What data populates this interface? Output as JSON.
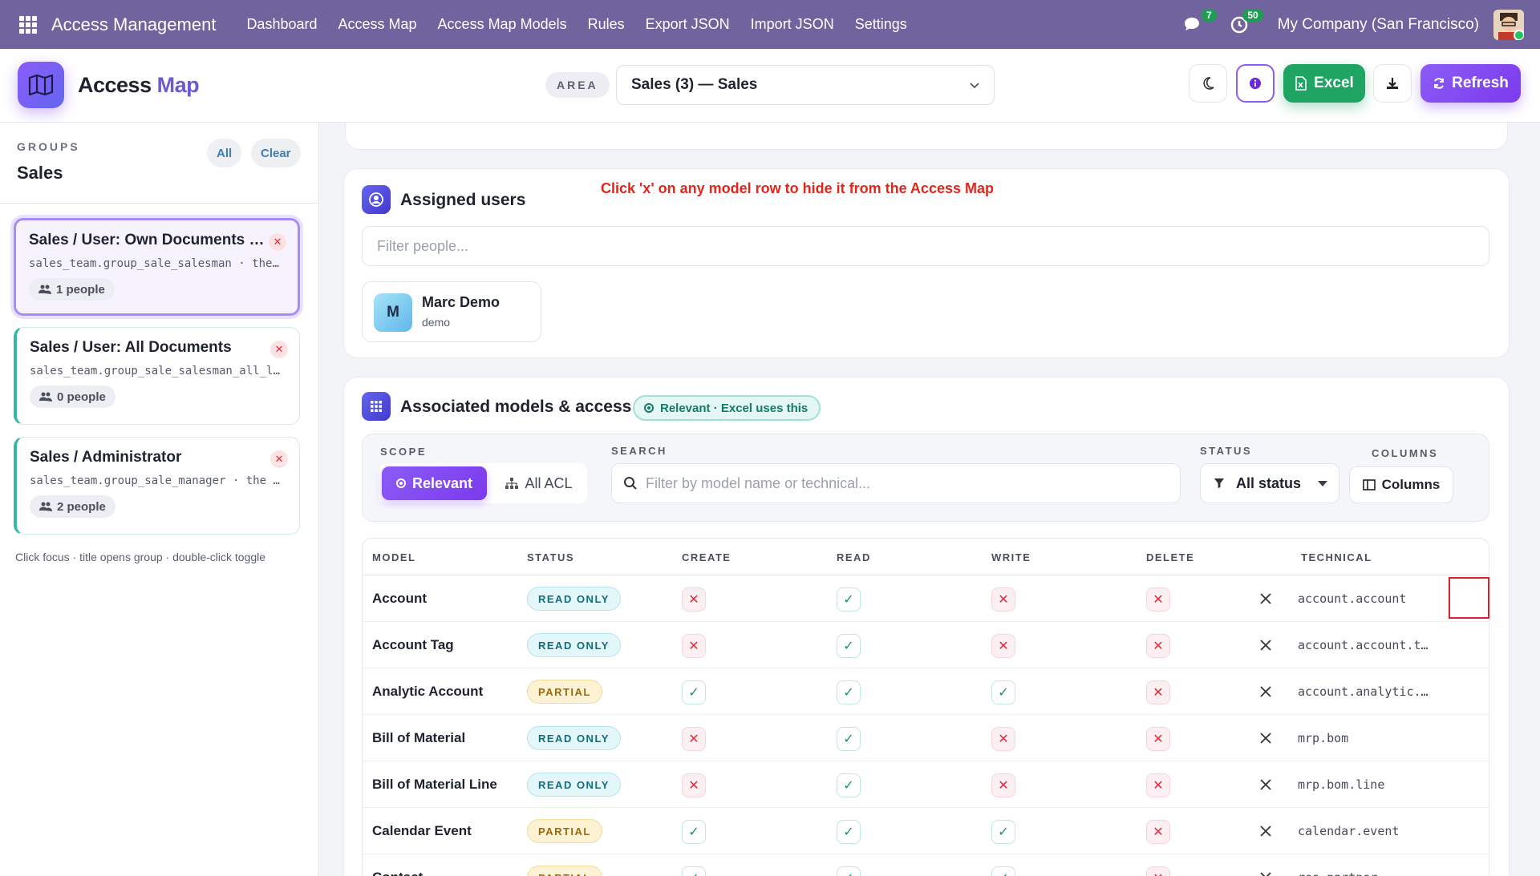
{
  "topbar": {
    "brand": "Access Management",
    "nav": [
      "Dashboard",
      "Access Map",
      "Access Map Models",
      "Rules",
      "Export JSON",
      "Import JSON",
      "Settings"
    ],
    "messages_count": "7",
    "activity_count": "50",
    "company": "My Company (San Francisco)"
  },
  "header": {
    "title_main": "Access",
    "title_accent": "Map",
    "area_label": "AREA",
    "area_value": "Sales (3) — Sales",
    "excel_label": "Excel",
    "refresh_label": "Refresh"
  },
  "sidebar": {
    "groups_label": "GROUPS",
    "groups_title": "Sales",
    "all_label": "All",
    "clear_label": "Clear",
    "groups": [
      {
        "title": "Sales / User: Own Documents Only",
        "tech": "sales_team.group_sale_salesman · the user will have access to his own data",
        "people": "1 people"
      },
      {
        "title": "Sales / User: All Documents",
        "tech": "sales_team.group_sale_salesman_all_leads",
        "people": "0 people"
      },
      {
        "title": "Sales / Administrator",
        "tech": "sales_team.group_sale_manager · the user will have access to all",
        "people": "2 people"
      }
    ],
    "hint": "Click focus · title opens group · double-click toggle"
  },
  "users": {
    "title": "Assigned users",
    "annotation": "Click 'x' on any model row to hide it from the Access Map",
    "filter_placeholder": "Filter people...",
    "list": [
      {
        "initial": "M",
        "name": "Marc Demo",
        "login": "demo"
      }
    ]
  },
  "models": {
    "title": "Associated models & access",
    "relevant_badge": "Relevant · Excel uses this",
    "scope_label": "SCOPE",
    "scope_relevant": "Relevant",
    "scope_all": "All ACL",
    "search_label": "SEARCH",
    "search_placeholder": "Filter by model name or technical...",
    "status_label": "STATUS",
    "status_value": "All status",
    "columns_label": "COLUMNS",
    "columns_button": "Columns",
    "headers": [
      "MODEL",
      "STATUS",
      "CREATE",
      "READ",
      "WRITE",
      "DELETE",
      "TECHNICAL"
    ],
    "rows": [
      {
        "model": "Account",
        "status": "READ ONLY",
        "kind": "read",
        "c": false,
        "r": true,
        "w": false,
        "d": false,
        "tech": "account.account"
      },
      {
        "model": "Account Tag",
        "status": "READ ONLY",
        "kind": "read",
        "c": false,
        "r": true,
        "w": false,
        "d": false,
        "tech": "account.account.tag"
      },
      {
        "model": "Analytic Account",
        "status": "PARTIAL",
        "kind": "part",
        "c": true,
        "r": true,
        "w": true,
        "d": false,
        "tech": "account.analytic.account"
      },
      {
        "model": "Bill of Material",
        "status": "READ ONLY",
        "kind": "read",
        "c": false,
        "r": true,
        "w": false,
        "d": false,
        "tech": "mrp.bom"
      },
      {
        "model": "Bill of Material Line",
        "status": "READ ONLY",
        "kind": "read",
        "c": false,
        "r": true,
        "w": false,
        "d": false,
        "tech": "mrp.bom.line"
      },
      {
        "model": "Calendar Event",
        "status": "PARTIAL",
        "kind": "part",
        "c": true,
        "r": true,
        "w": true,
        "d": false,
        "tech": "calendar.event"
      },
      {
        "model": "Contact",
        "status": "PARTIAL",
        "kind": "part",
        "c": true,
        "r": true,
        "w": true,
        "d": false,
        "tech": "res.partner"
      }
    ]
  },
  "colors": {
    "navbar": "#71639e",
    "accent": "#7c3aed",
    "excel": "#1fa463",
    "teal": "#2fb9a8",
    "highlight": "#e11d2e"
  }
}
